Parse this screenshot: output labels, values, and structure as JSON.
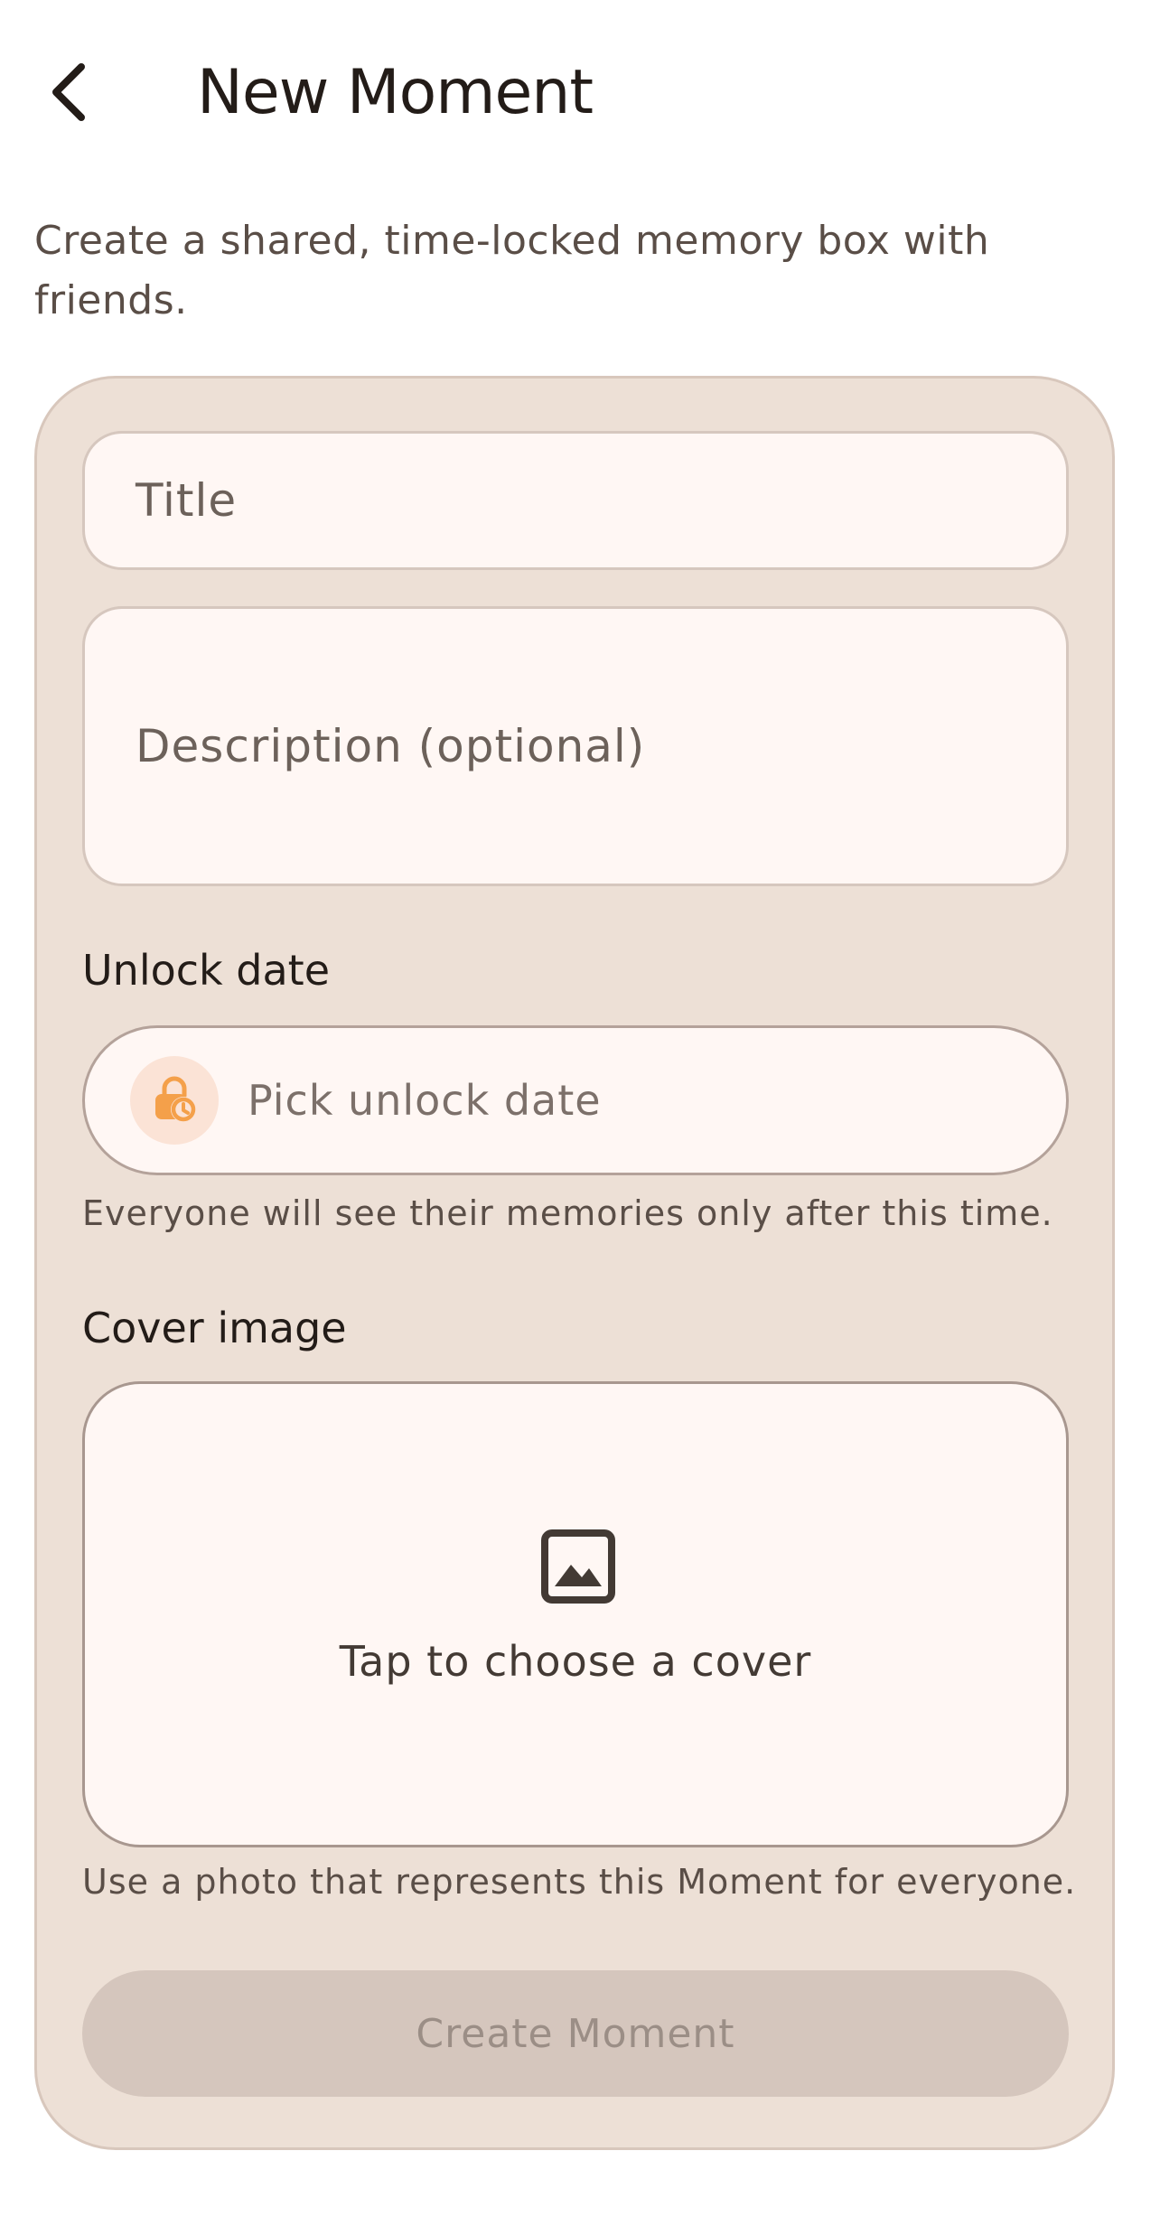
{
  "header": {
    "title": "New Moment",
    "back_icon": "chevron-left-icon"
  },
  "intro": {
    "text": "Create a shared, time-locked memory box with friends."
  },
  "form": {
    "title_placeholder": "Title",
    "description_placeholder": "Description (optional)",
    "unlock": {
      "label": "Unlock date",
      "placeholder": "Pick unlock date",
      "icon": "lock-clock-icon",
      "helper": "Everyone will see their memories only after this time."
    },
    "cover": {
      "label": "Cover image",
      "prompt": "Tap to choose a cover",
      "icon": "image-icon",
      "helper": "Use a photo that represents this Moment for everyone."
    },
    "submit_label": "Create Moment",
    "submit_disabled": true
  },
  "colors": {
    "background": "#FFFFFF",
    "card": "#EDE0D6",
    "field": "#FFF7F4",
    "accent": "#F4A04A",
    "button_disabled": "#D5C6BD"
  }
}
